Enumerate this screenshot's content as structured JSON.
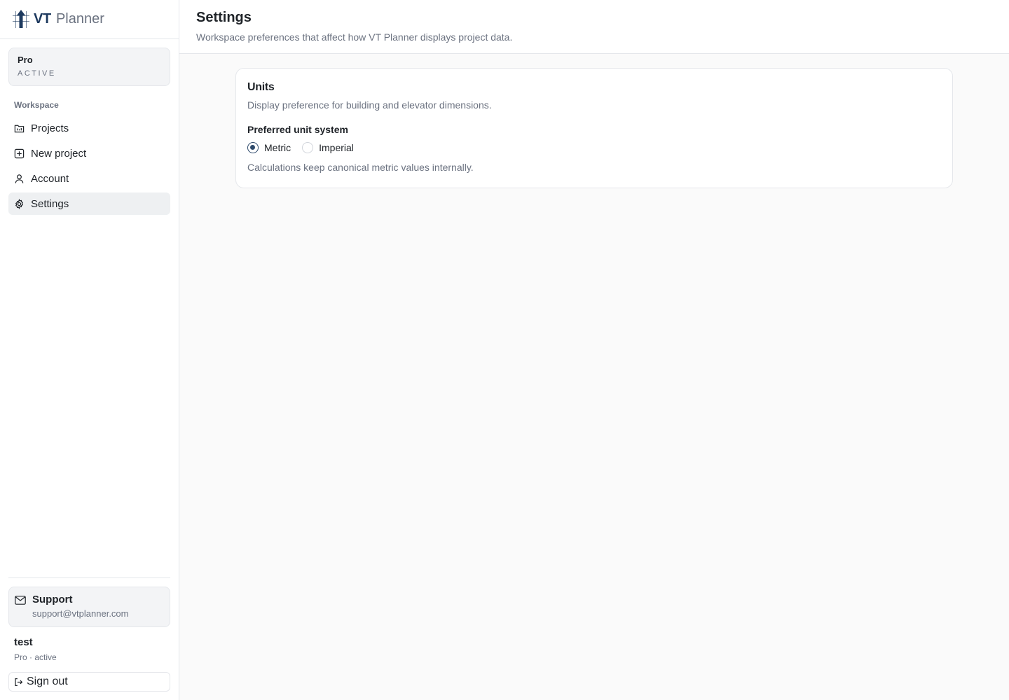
{
  "brand": {
    "name_bold": "VT",
    "name_light": "Planner",
    "accent_color": "#1e3a5f"
  },
  "plan": {
    "name": "Pro",
    "status": "ACTIVE"
  },
  "sidebar": {
    "section_label": "Workspace",
    "items": [
      {
        "label": "Projects",
        "icon": "projects-icon",
        "active": false
      },
      {
        "label": "New project",
        "icon": "plus-square-icon",
        "active": false
      },
      {
        "label": "Account",
        "icon": "user-icon",
        "active": false
      },
      {
        "label": "Settings",
        "icon": "gear-icon",
        "active": true
      }
    ]
  },
  "support": {
    "title": "Support",
    "email": "support@vtplanner.com"
  },
  "user": {
    "name": "test",
    "plan": "Pro · active"
  },
  "signout": {
    "label": "Sign out"
  },
  "header": {
    "title": "Settings",
    "subtitle": "Workspace preferences that affect how VT Planner displays project data."
  },
  "units_card": {
    "title": "Units",
    "description": "Display preference for building and elevator dimensions.",
    "field_label": "Preferred unit system",
    "options": [
      {
        "label": "Metric",
        "selected": true
      },
      {
        "label": "Imperial",
        "selected": false
      }
    ],
    "note": "Calculations keep canonical metric values internally."
  }
}
